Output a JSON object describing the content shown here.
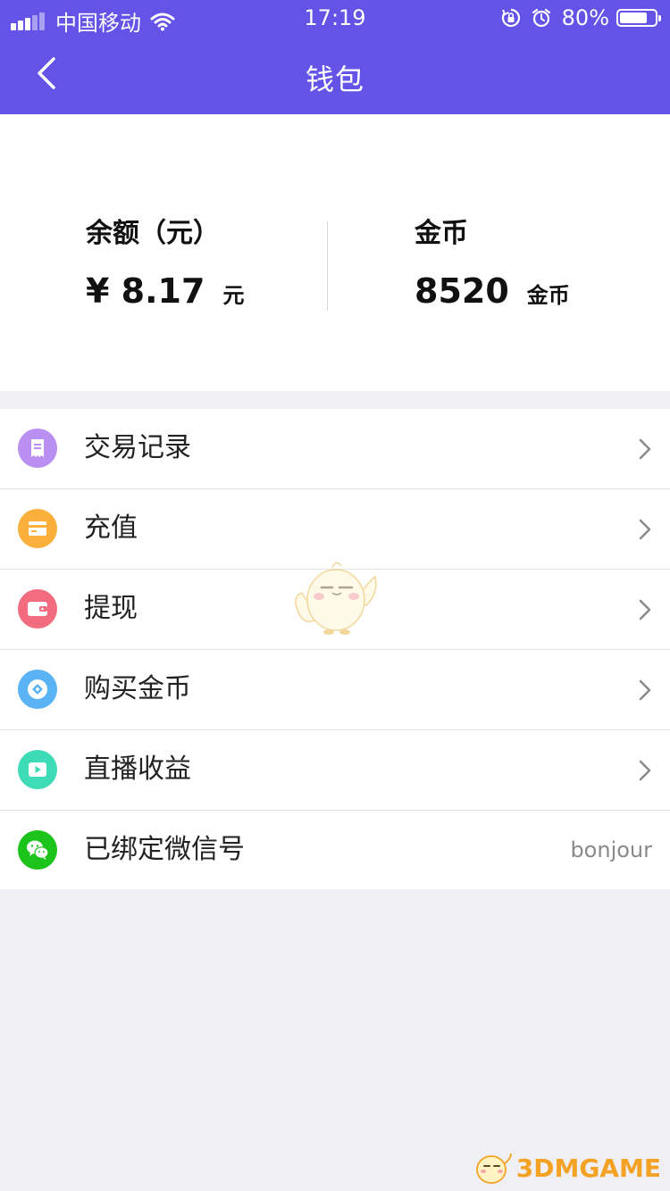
{
  "status_bar": {
    "carrier": "中国移动",
    "time": "17:19",
    "battery": "80%",
    "battery_level": 0.8
  },
  "nav": {
    "title": "钱包",
    "back_icon": "chevron-left-icon"
  },
  "summary": {
    "balance_label": "余额（元）",
    "balance_value": "¥ 8.17",
    "balance_unit": "元",
    "coins_label": "金币",
    "coins_value": "8520",
    "coins_unit": "金币"
  },
  "menu": {
    "items": [
      {
        "label": "交易记录",
        "icon": "receipt-icon",
        "color": "#b98ff2"
      },
      {
        "label": "充值",
        "icon": "card-icon",
        "color": "#fbb03b"
      },
      {
        "label": "提现",
        "icon": "wallet-icon",
        "color": "#f26b7f"
      },
      {
        "label": "购买金币",
        "icon": "diamond-coin-icon",
        "color": "#5ab3f5"
      },
      {
        "label": "直播收益",
        "icon": "play-icon",
        "color": "#3ddbb6"
      },
      {
        "label": "已绑定微信号",
        "icon": "wechat-icon",
        "color": "#1cc31b",
        "value": "bonjour"
      }
    ]
  },
  "watermark": {
    "text": "3DMGAME"
  },
  "colors": {
    "header": "#6353e6",
    "background": "#efeff4"
  }
}
